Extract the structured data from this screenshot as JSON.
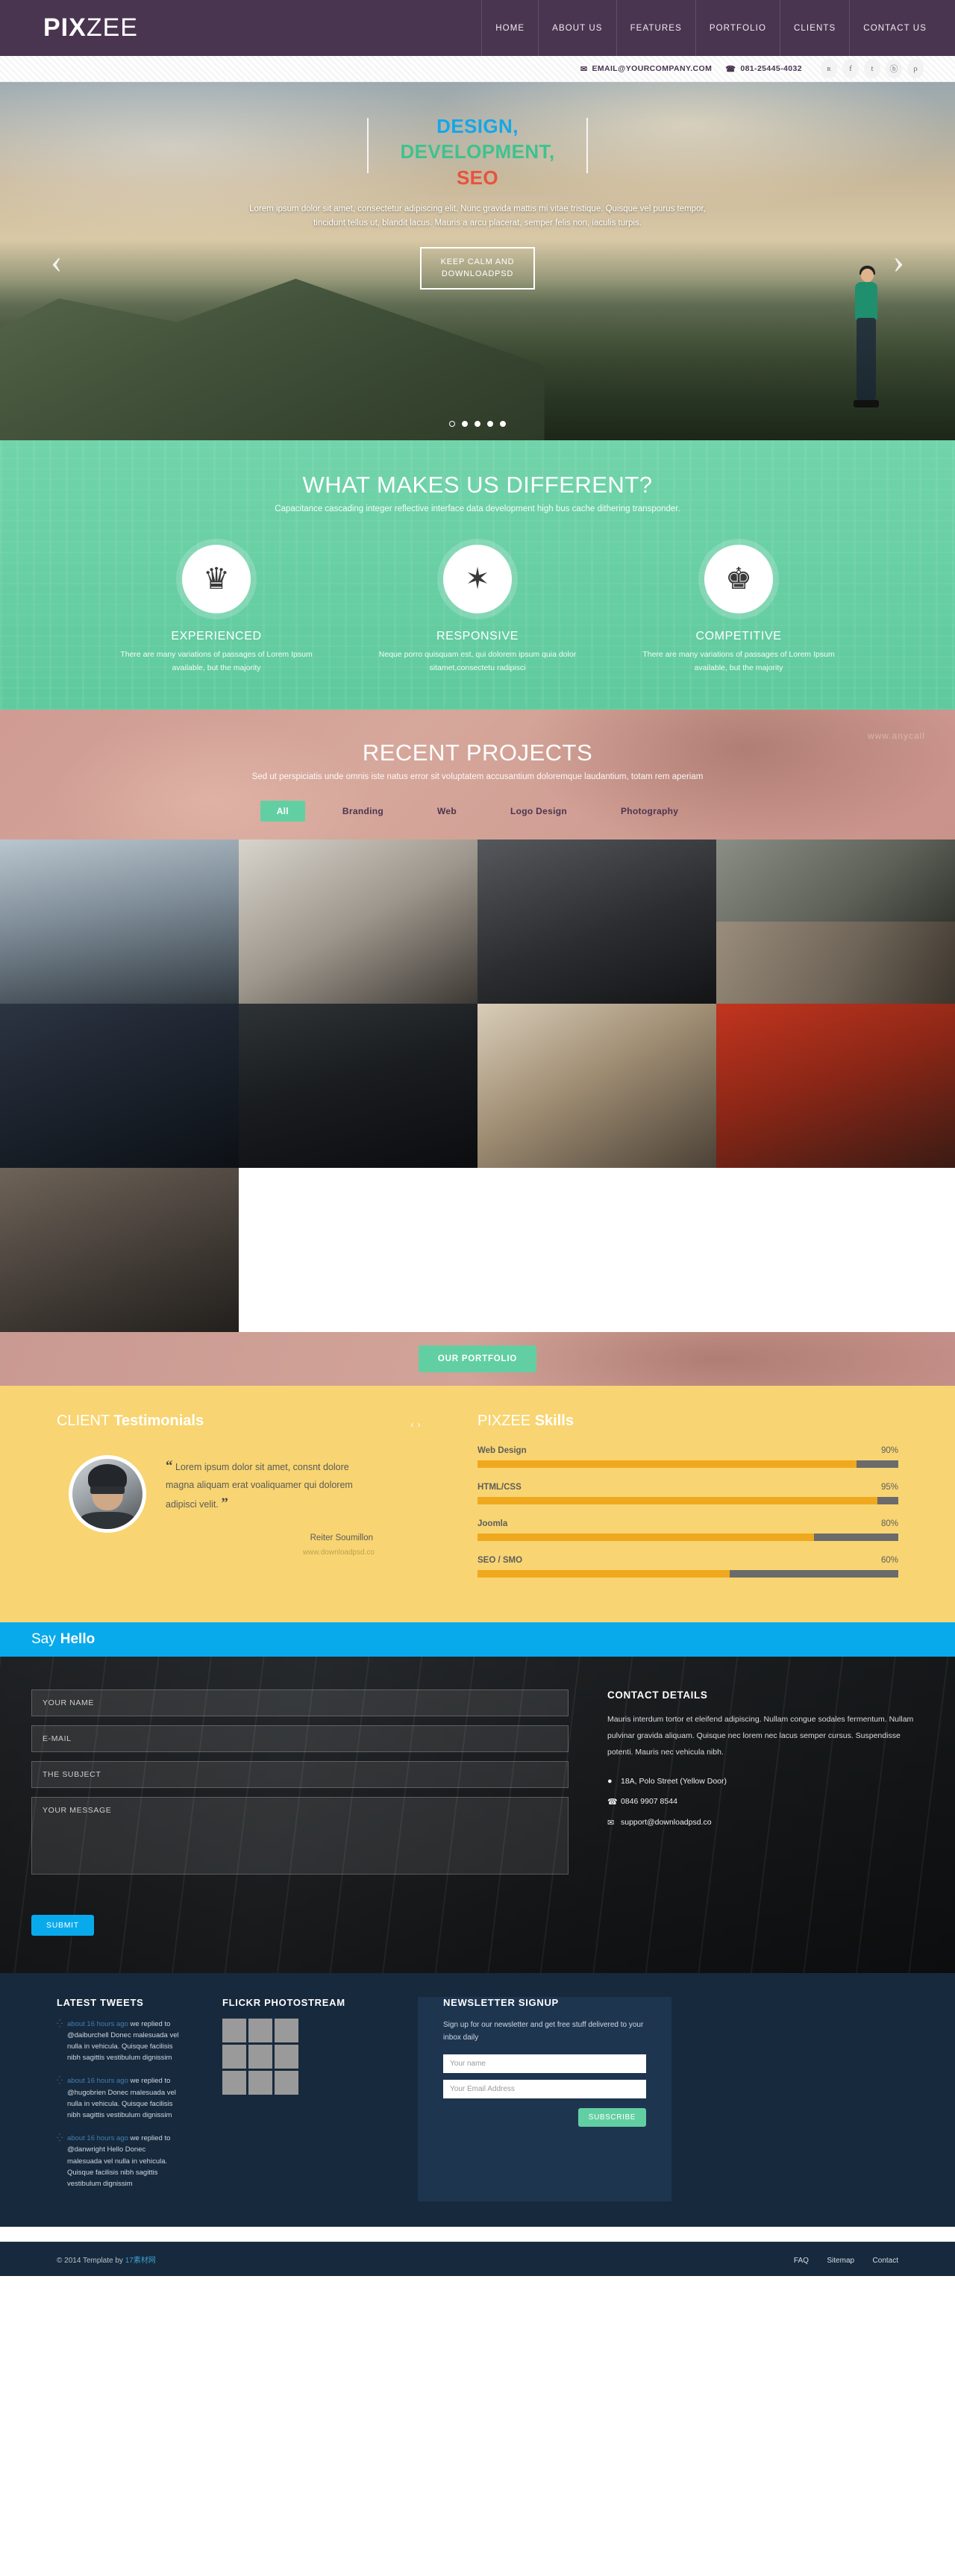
{
  "brand": {
    "bold": "PIX",
    "light": "ZEE"
  },
  "nav": {
    "items": [
      "HOME",
      "ABOUT US",
      "FEATURES",
      "PORTFOLIO",
      "CLIENTS",
      "CONTACT US"
    ]
  },
  "topbar": {
    "email_icon": "envelope-icon",
    "email": "EMAIL@YOURCOMPANY.COM",
    "phone_icon": "phone-icon",
    "phone": "081-25445-4032",
    "social": [
      {
        "name": "rss-icon",
        "glyph": "ʀ"
      },
      {
        "name": "facebook-icon",
        "glyph": "f"
      },
      {
        "name": "twitter-icon",
        "glyph": "t"
      },
      {
        "name": "dribbble-icon",
        "glyph": "ⓑ"
      },
      {
        "name": "pinterest-icon",
        "glyph": "ρ"
      }
    ]
  },
  "hero": {
    "line1": "DESIGN,",
    "line2": "DEVELOPMENT,",
    "line3": "SEO",
    "paragraph": "Lorem ipsum dolor sit amet, consectetur adipiscing elit. Nunc gravida mattis mi vitae tristique. Quisque vel purus tempor, tincidunt tellus ut, blandit lacus. Mauris a arcu placerat, semper felis non, iaculis turpis.",
    "button_line1": "KEEP CALM AND",
    "button_line2": "DOWNLOADPSD",
    "prev": "‹",
    "next": "›",
    "dots": 5,
    "active_dot": 1,
    "colors": {
      "design": "#14a7e8",
      "development": "#3ec28f",
      "seo": "#e8523f"
    }
  },
  "features": {
    "title": "WHAT MAKES US DIFFERENT?",
    "subtitle": "Capacitance cascading integer reflective interface data development high bus cache dithering transponder.",
    "items": [
      {
        "icon": "crown-icon",
        "glyph": "♛",
        "title": "EXPERIENCED",
        "text": "There are many variations of passages of Lorem Ipsum available, but the majority"
      },
      {
        "icon": "badge-star-icon",
        "glyph": "✶",
        "title": "RESPONSIVE",
        "text": "Neque porro quisquam est, qui dolorem ipsum quia dolor sitamet,consectetu radipisci"
      },
      {
        "icon": "king-chess-icon",
        "glyph": "♚",
        "title": "COMPETITIVE",
        "text": "There are many variations of passages of Lorem Ipsum available, but the majority"
      }
    ]
  },
  "portfolio": {
    "title": "RECENT PROJECTS",
    "subtitle": "Sed ut perspiciatis unde omnis iste natus error sit voluptatem accusantium doloremque laudantium, totam rem aperiam",
    "watermark": "www.anycall",
    "filters": [
      "All",
      "Branding",
      "Web",
      "Logo Design",
      "Photography"
    ],
    "active_filter": "All",
    "button": "OUR PORTFOLIO"
  },
  "testimonials": {
    "title_light": "CLIENT",
    "title_bold": "Testimonials",
    "prev": "‹",
    "next": "›",
    "quote": "Lorem ipsum dolor sit amet, consnt dolore magna aliquam erat voaliquamer qui dolorem adipisci velit.",
    "author": "Reiter Soumillon",
    "site": "www.downloadpsd.co"
  },
  "skills": {
    "title_light": "PIXZEE",
    "title_bold": "Skills"
  },
  "chart_data": {
    "type": "bar",
    "title": "PIXZEE Skills",
    "orientation": "horizontal",
    "categories": [
      "Web Design",
      "HTML/CSS",
      "Joomla",
      "SEO / SMO"
    ],
    "values": [
      90,
      95,
      80,
      60
    ],
    "value_labels": [
      "90%",
      "95%",
      "80%",
      "60%"
    ],
    "ylim": [
      0,
      100
    ],
    "xlabel": "",
    "ylabel": "",
    "grid": false,
    "legend": null,
    "fill_color": "#f0a81e",
    "track_color": "#6b6b6b"
  },
  "contact": {
    "hello_light": "Say",
    "hello_bold": "Hello",
    "form": {
      "name_placeholder": "YOUR NAME",
      "email_placeholder": "E-MAIL",
      "subject_placeholder": "THE SUBJECT",
      "message_placeholder": "YOUR MESSAGE",
      "submit": "SUBMIT"
    },
    "details": {
      "title": "CONTACT DETAILS",
      "text": "Mauris interdum tortor et eleifend adipiscing. Nullam congue sodales fermentum. Nullam pulvinar gravida aliquam. Quisque nec lorem nec lacus semper cursus. Suspendisse potenti. Mauris nec vehicula nibh.",
      "address_icon": "map-pin-icon",
      "address": "18A, Polo Street (Yellow Door)",
      "phone_icon": "phone-icon",
      "phone": "0846 9907 8544",
      "email_icon": "envelope-icon",
      "email": "support@downloadpsd.co"
    }
  },
  "footer": {
    "tweets_title": "LATEST TWEETS",
    "tweets": [
      {
        "time": "about 16 hours ago",
        "text": "we replied to @daiburchell Donec malesuada vel nulla in vehicula. Quisque facilisis nibh sagittis vestibulum dignissim"
      },
      {
        "time": "about 16 hours ago",
        "text": "we replied to @hugobrien Donec malesuada vel nulla in vehicula. Quisque facilisis nibh sagittis vestibulum dignissim"
      },
      {
        "time": "about 16 hours ago",
        "text": "we replied to @danwright Hello Donec malesuada vel nulla in vehicula. Quisque facilisis nibh sagittis vestibulum dignissim"
      }
    ],
    "flickr_title": "FLICKR PHOTOSTREAM",
    "flickr_count": 9,
    "news_title": "NEWSLETTER SIGNUP",
    "news_text": "Sign up for our newsletter and get free stuff delivered to your inbox daily",
    "news_name_placeholder": "Your name",
    "news_email_placeholder": "Your Email Address",
    "news_button": "SUBSCRIBE",
    "copyright_prefix": "© 2014 Template by ",
    "copyright_link": "17素材网",
    "bottom_links": [
      "FAQ",
      "Sitemap",
      "Contact"
    ]
  }
}
